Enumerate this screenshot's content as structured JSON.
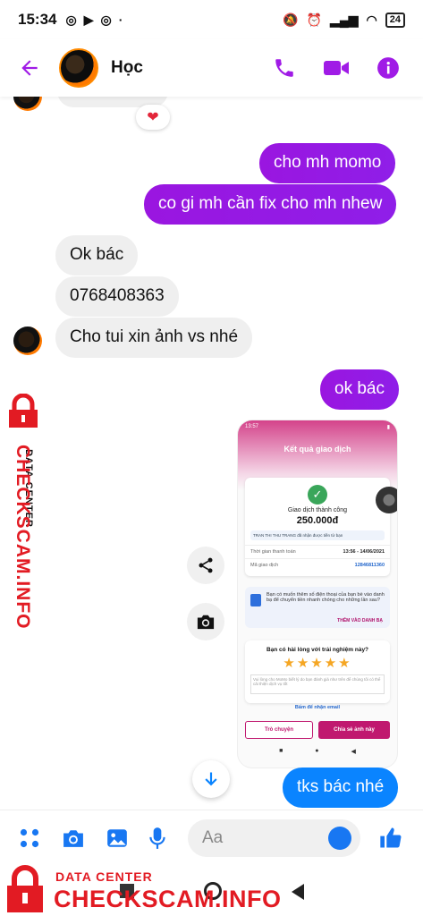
{
  "status_bar": {
    "time": "15:34",
    "battery": "24"
  },
  "header": {
    "contact_name": "Học"
  },
  "messages": [
    {
      "side": "in",
      "text": ""
    },
    {
      "side": "out",
      "text": "cho mh momo"
    },
    {
      "side": "out",
      "text": "co gi mh cần fix cho mh nhew"
    },
    {
      "side": "in",
      "text": "Ok bác"
    },
    {
      "side": "in",
      "text": "0768408363"
    },
    {
      "side": "in",
      "text": "Cho tui xin ảnh vs nhé"
    },
    {
      "side": "out",
      "text": "ok bác"
    },
    {
      "side": "out",
      "text": "tks bác nhé"
    }
  ],
  "reaction": "❤",
  "shared_image": {
    "status_time": "13:57",
    "title": "Kết quả giao dịch",
    "status": "Giao dịch thành công",
    "amount": "250.000đ",
    "note": "TRAN THI THU TRANG đã nhận được tiền từ bạn",
    "rows": [
      {
        "label": "Thời gian thanh toán",
        "value": "13:56 - 14/06/2021"
      },
      {
        "label": "Mã giao dịch",
        "value": "12846811360"
      }
    ],
    "promo_text": "Bạn có muốn thêm số điện thoại của bạn bè vào danh bạ để chuyển tiền nhanh chóng cho những lần sau?",
    "promo_link": "THÊM VÀO DANH BẠ",
    "rating_question": "Bạn có hài lòng với trải nghiệm này?",
    "rating_placeholder": "Vui lòng cho MoMo biết lý do bạn đánh giá như trên để chúng tôi có thể cải thiện dịch vụ tốt",
    "email_link": "Bấm để nhận email",
    "btn_chat": "Trò chuyện",
    "btn_share": "Chia sẻ ảnh này"
  },
  "composer": {
    "placeholder": "Aa"
  },
  "watermark": {
    "small": "DATA CENTER",
    "big": "CHECKSCAM.INFO"
  },
  "colors": {
    "accent": "#9a16e0",
    "blue": "#0a84ff",
    "watermark": "#e21b23"
  }
}
